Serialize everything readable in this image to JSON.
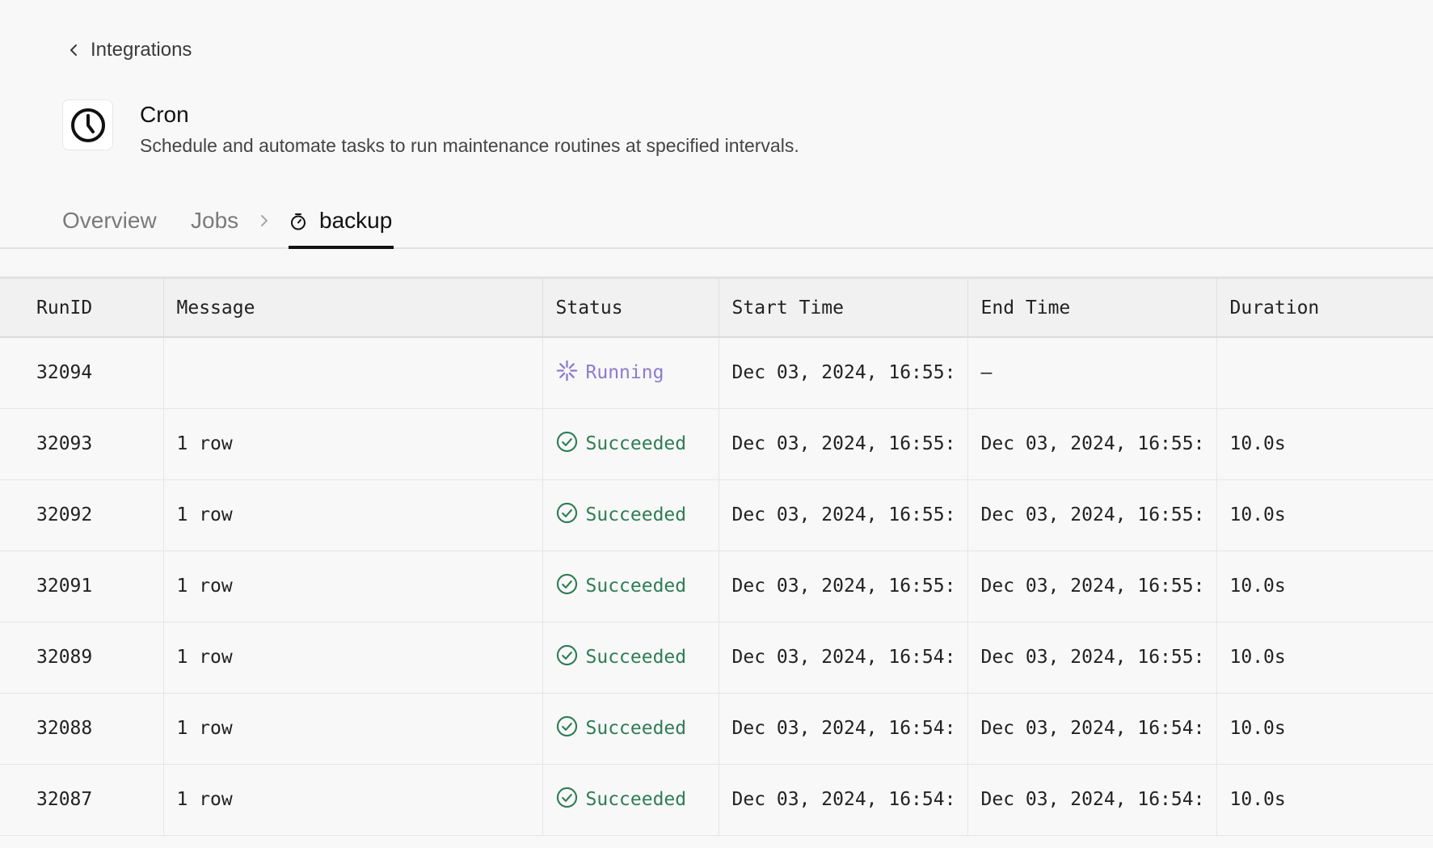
{
  "breadcrumb": {
    "back_label": "Integrations"
  },
  "integration": {
    "name": "Cron",
    "description": "Schedule and automate tasks to run maintenance routines at specified intervals.",
    "icon": "clock-icon"
  },
  "tabs": {
    "overview": "Overview",
    "jobs": "Jobs",
    "active": "backup"
  },
  "table": {
    "columns": [
      "RunID",
      "Message",
      "Status",
      "Start Time",
      "End Time",
      "Duration"
    ],
    "rows": [
      {
        "run_id": "32094",
        "message": "",
        "status": "Running",
        "status_type": "running",
        "start": "Dec 03, 2024, 16:55:",
        "end": "–",
        "duration": ""
      },
      {
        "run_id": "32093",
        "message": "1 row",
        "status": "Succeeded",
        "status_type": "ok",
        "start": "Dec 03, 2024, 16:55:",
        "end": "Dec 03, 2024, 16:55:",
        "duration": "10.0s"
      },
      {
        "run_id": "32092",
        "message": "1 row",
        "status": "Succeeded",
        "status_type": "ok",
        "start": "Dec 03, 2024, 16:55:",
        "end": "Dec 03, 2024, 16:55:",
        "duration": "10.0s"
      },
      {
        "run_id": "32091",
        "message": "1 row",
        "status": "Succeeded",
        "status_type": "ok",
        "start": "Dec 03, 2024, 16:55:",
        "end": "Dec 03, 2024, 16:55:",
        "duration": "10.0s"
      },
      {
        "run_id": "32089",
        "message": "1 row",
        "status": "Succeeded",
        "status_type": "ok",
        "start": "Dec 03, 2024, 16:54:",
        "end": "Dec 03, 2024, 16:55:",
        "duration": "10.0s"
      },
      {
        "run_id": "32088",
        "message": "1 row",
        "status": "Succeeded",
        "status_type": "ok",
        "start": "Dec 03, 2024, 16:54:",
        "end": "Dec 03, 2024, 16:54:",
        "duration": "10.0s"
      },
      {
        "run_id": "32087",
        "message": "1 row",
        "status": "Succeeded",
        "status_type": "ok",
        "start": "Dec 03, 2024, 16:54:",
        "end": "Dec 03, 2024, 16:54:",
        "duration": "10.0s"
      }
    ]
  },
  "colors": {
    "success": "#2f7d55",
    "running": "#8c7bd1",
    "background": "#f8f8f8"
  }
}
